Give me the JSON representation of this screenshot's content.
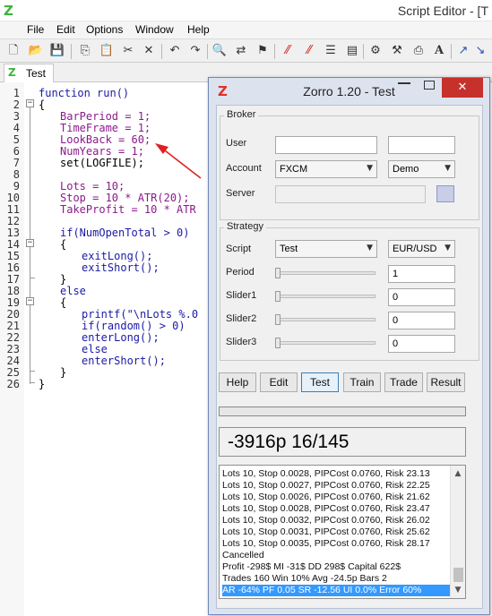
{
  "editor": {
    "title": "Script Editor - [T",
    "logo": "Z",
    "menu": [
      "File",
      "Edit",
      "Options",
      "Window",
      "Help"
    ],
    "tab_label": "Test",
    "toolbar_icons": [
      "new-file",
      "open-folder",
      "save",
      "copy",
      "paste",
      "cut",
      "delete",
      "undo",
      "redo",
      "find",
      "replace",
      "bookmark-toggle",
      "bookmark-next",
      "bookmark-clear",
      "indent",
      "comment",
      "run",
      "settings",
      "print",
      "font",
      "arrow-1",
      "arrow-2",
      "arrow-3"
    ],
    "code_lines": [
      {
        "num": "1",
        "text": "function run()",
        "ind": 0,
        "cls": "kw",
        "fold": ""
      },
      {
        "num": "2",
        "text": "{",
        "ind": 0,
        "cls": "",
        "fold": "open"
      },
      {
        "num": "3",
        "text": "BarPeriod = 1;",
        "ind": 1,
        "cls": "pr",
        "fold": ""
      },
      {
        "num": "4",
        "text": "TimeFrame = 1;",
        "ind": 1,
        "cls": "pr",
        "fold": ""
      },
      {
        "num": "5",
        "text": "LookBack = 60;",
        "ind": 1,
        "cls": "pr",
        "fold": ""
      },
      {
        "num": "6",
        "text": "NumYears = 1;",
        "ind": 1,
        "cls": "pr",
        "fold": ""
      },
      {
        "num": "7",
        "text": "set(LOGFILE);",
        "ind": 1,
        "cls": "",
        "fold": ""
      },
      {
        "num": "8",
        "text": "",
        "ind": 1,
        "cls": "",
        "fold": ""
      },
      {
        "num": "9",
        "text": "Lots = 10;",
        "ind": 1,
        "cls": "pr",
        "fold": ""
      },
      {
        "num": "10",
        "text": "Stop = 10 * ATR(20);",
        "ind": 1,
        "cls": "pr",
        "fold": ""
      },
      {
        "num": "11",
        "text": "TakeProfit = 10 * ATR",
        "ind": 1,
        "cls": "pr",
        "fold": ""
      },
      {
        "num": "12",
        "text": "",
        "ind": 1,
        "cls": "",
        "fold": ""
      },
      {
        "num": "13",
        "text": "if(NumOpenTotal > 0)",
        "ind": 1,
        "cls": "kw",
        "fold": ""
      },
      {
        "num": "14",
        "text": "{",
        "ind": 1,
        "cls": "",
        "fold": "open"
      },
      {
        "num": "15",
        "text": "exitLong();",
        "ind": 2,
        "cls": "kw",
        "fold": ""
      },
      {
        "num": "16",
        "text": "exitShort();",
        "ind": 2,
        "cls": "kw",
        "fold": ""
      },
      {
        "num": "17",
        "text": "}",
        "ind": 1,
        "cls": "",
        "fold": "end"
      },
      {
        "num": "18",
        "text": "else",
        "ind": 1,
        "cls": "kw",
        "fold": ""
      },
      {
        "num": "19",
        "text": "{",
        "ind": 1,
        "cls": "",
        "fold": "open"
      },
      {
        "num": "20",
        "text": "printf(\"\\nLots %.0",
        "ind": 2,
        "cls": "kw",
        "fold": ""
      },
      {
        "num": "21",
        "text": "if(random() > 0)",
        "ind": 2,
        "cls": "kw",
        "fold": ""
      },
      {
        "num": "22",
        "text": "enterLong();",
        "ind": 2,
        "cls": "kw",
        "fold": ""
      },
      {
        "num": "23",
        "text": "else",
        "ind": 2,
        "cls": "kw",
        "fold": ""
      },
      {
        "num": "24",
        "text": "enterShort();",
        "ind": 2,
        "cls": "kw",
        "fold": ""
      },
      {
        "num": "25",
        "text": "}",
        "ind": 1,
        "cls": "",
        "fold": "end"
      },
      {
        "num": "26",
        "text": "}",
        "ind": 0,
        "cls": "",
        "fold": "end"
      }
    ]
  },
  "zorro": {
    "logo": "Z",
    "title": "Zorro 1.20 - Test",
    "close_glyph": "✕",
    "broker": {
      "group_label": "Broker",
      "user_label": "User",
      "user_value": "",
      "password_value": "",
      "account_label": "Account",
      "account_value": "FXCM",
      "mode_value": "Demo",
      "server_label": "Server",
      "server_value": ""
    },
    "strategy": {
      "group_label": "Strategy",
      "script_label": "Script",
      "script_value": "Test",
      "asset_value": "EUR/USD",
      "sliders": [
        {
          "label": "Period",
          "value": "1"
        },
        {
          "label": "Slider1",
          "value": "0"
        },
        {
          "label": "Slider2",
          "value": "0"
        },
        {
          "label": "Slider3",
          "value": "0"
        }
      ]
    },
    "buttons": [
      "Help",
      "Edit",
      "Test",
      "Train",
      "Trade",
      "Result"
    ],
    "active_button": "Test",
    "progress_fraction": 0,
    "result": "-3916p 16/145",
    "log": [
      "Lots 10, Stop 0.0028, PIPCost 0.0760, Risk 23.13",
      "Lots 10, Stop 0.0027, PIPCost 0.0760, Risk 22.25",
      "Lots 10, Stop 0.0026, PIPCost 0.0760, Risk 21.62",
      "Lots 10, Stop 0.0028, PIPCost 0.0760, Risk 23.47",
      "Lots 10, Stop 0.0032, PIPCost 0.0760, Risk 26.02",
      "Lots 10, Stop 0.0031, PIPCost 0.0760, Risk 25.62",
      "Lots 10, Stop 0.0035, PIPCost 0.0760, Risk 28.17",
      "Cancelled",
      "Profit -298$  MI -31$  DD 298$  Capital 622$",
      "Trades 160  Win 10%  Avg -24.5p  Bars 2",
      "AR -64%  PF 0.05  SR -12.56  UI 0.0%  Error 60%"
    ],
    "log_selected_index": 10
  },
  "colors": {
    "keyword": "#1a1aa6",
    "parameter": "#8b1a8b",
    "logo_green": "#3cb43c",
    "logo_red": "#e0302a",
    "close_red": "#c7312b",
    "selection": "#3399ff",
    "annotation_arrow": "#e02020"
  }
}
